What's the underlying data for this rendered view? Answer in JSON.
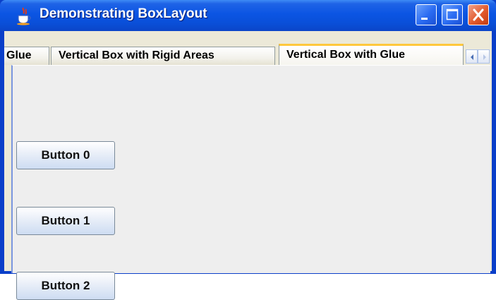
{
  "window": {
    "title": "Demonstrating BoxLayout",
    "title_color": "#FFFFFF",
    "title_bar_color": "#0B55E3",
    "controls": [
      "minimize-icon",
      "maximize-icon",
      "close-icon"
    ],
    "app_icon": "java-cup-icon"
  },
  "tabs": [
    {
      "label": "Glue",
      "visible_text": "Glue",
      "partial": true
    },
    {
      "label": "Vertical Box with Rigid Areas"
    },
    {
      "label": "Vertical Box with Glue",
      "selected": true
    }
  ],
  "tab_scroll": [
    "scroll-left-icon",
    "scroll-right-icon"
  ],
  "buttons": [
    {
      "label": "Button 0"
    },
    {
      "label": "Button 1"
    },
    {
      "label": "Button 2"
    }
  ],
  "colors": {
    "panel_bg": "#EEEEEE",
    "selected_tab_accent": "#FFC83C",
    "close_button": "#E25A2C"
  }
}
